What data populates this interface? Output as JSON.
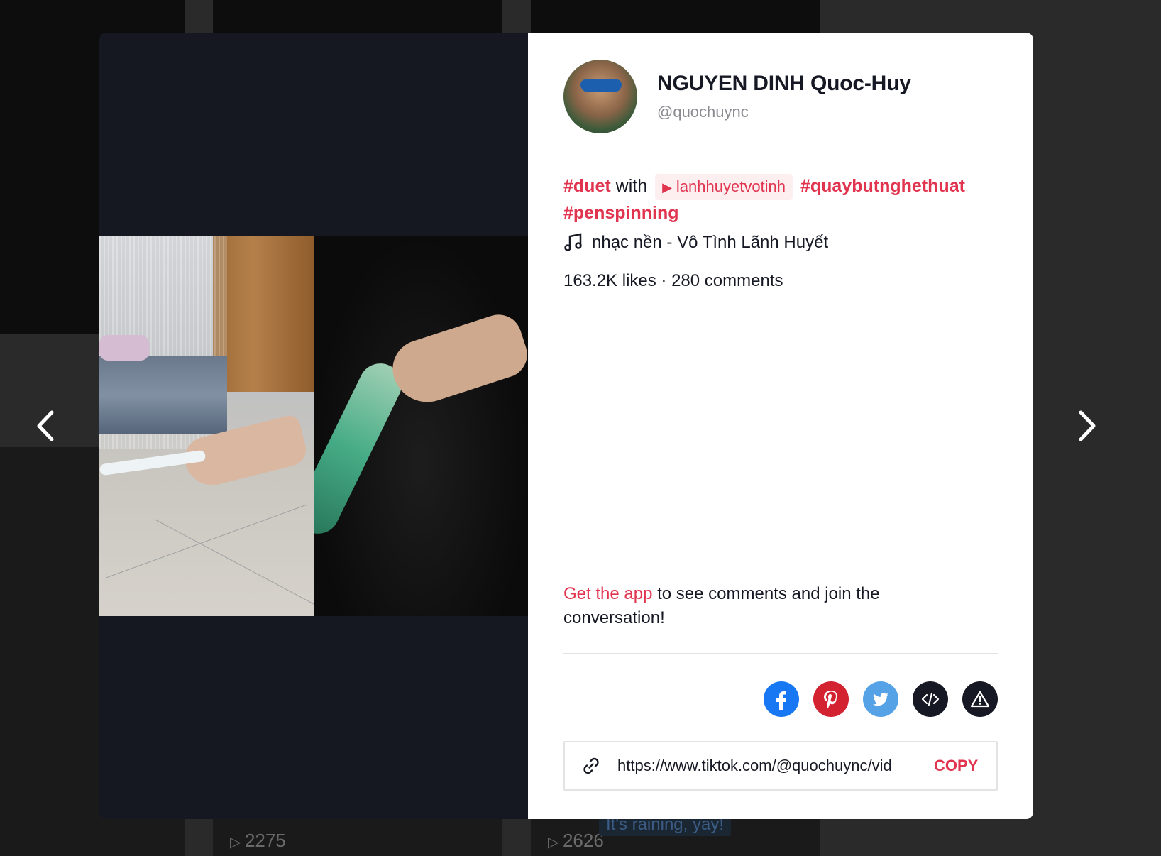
{
  "background": {
    "tile_counts": [
      "2275",
      "2626"
    ],
    "tile_caption": "It's raining, yay!"
  },
  "nav": {
    "prev_icon": "chevron-left-icon",
    "next_icon": "chevron-right-icon"
  },
  "author": {
    "nickname": "NGUYEN DINH Quoc-Huy",
    "username": "@quochuync"
  },
  "description": {
    "hashtag_duet": "#duet",
    "with_text": "with",
    "duet_user": "lanhhuyetvotinh",
    "hashtag_2": "#quaybutnghethuat",
    "hashtag_3": "#penspinning"
  },
  "music": {
    "icon": "music-note-icon",
    "title": "nhạc nền - Vô Tình Lãnh Huyết"
  },
  "stats": {
    "text": "163.2K likes · 280 comments"
  },
  "get_app": {
    "link_text": "Get the app",
    "rest_text": " to see comments and join the conversation!"
  },
  "share": {
    "buttons": [
      {
        "name": "facebook",
        "icon": "facebook-icon",
        "color": "#1877f2"
      },
      {
        "name": "pinterest",
        "icon": "pinterest-icon",
        "color": "#d32331"
      },
      {
        "name": "twitter",
        "icon": "twitter-icon",
        "color": "#55a2e6"
      },
      {
        "name": "embed",
        "icon": "embed-code-icon",
        "color": "#161823"
      },
      {
        "name": "report",
        "icon": "warning-icon",
        "color": "#161823"
      }
    ]
  },
  "link": {
    "url": "https://www.tiktok.com/@quochuync/vid",
    "copy_label": "COPY"
  },
  "colors": {
    "accent": "#e0344f",
    "text": "#161823",
    "muted": "#8a8b91",
    "video_bg": "#151821"
  }
}
